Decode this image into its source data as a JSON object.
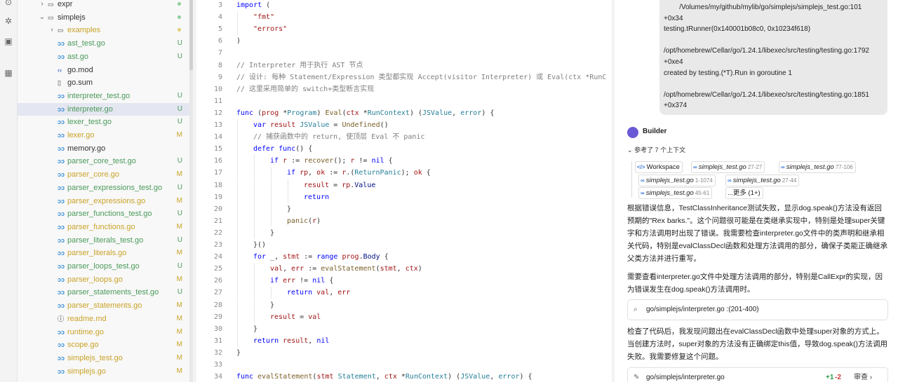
{
  "activity_bar": {
    "icons": [
      "explorer-icon",
      "debug-icon",
      "monitor-icon",
      "extensions-icon"
    ]
  },
  "explorer": {
    "colors": {
      "untracked": "#4a9a5a",
      "modified": "#c9a227",
      "normal": "#333333"
    },
    "rows": [
      {
        "name": "expr",
        "type": "folder",
        "depth": 1,
        "expanded": false,
        "badge": "",
        "status": "normal"
      },
      {
        "name": "simplejs",
        "type": "folder",
        "depth": 1,
        "expanded": true,
        "badge": "",
        "status": "normal"
      },
      {
        "name": "examples",
        "type": "folder",
        "depth": 2,
        "expanded": false,
        "badge": "",
        "status": "modified"
      },
      {
        "name": "ast_test.go",
        "type": "go",
        "depth": 2,
        "badge": "U",
        "status": "untracked"
      },
      {
        "name": "ast.go",
        "type": "go",
        "depth": 2,
        "badge": "U",
        "status": "untracked"
      },
      {
        "name": "go.mod",
        "type": "mod",
        "depth": 2,
        "badge": "",
        "status": "normal"
      },
      {
        "name": "go.sum",
        "type": "sum",
        "depth": 2,
        "badge": "",
        "status": "normal"
      },
      {
        "name": "interpreter_test.go",
        "type": "go",
        "depth": 2,
        "badge": "U",
        "status": "untracked"
      },
      {
        "name": "interpreter.go",
        "type": "go",
        "depth": 2,
        "badge": "U",
        "status": "untracked",
        "selected": true
      },
      {
        "name": "lexer_test.go",
        "type": "go",
        "depth": 2,
        "badge": "U",
        "status": "untracked"
      },
      {
        "name": "lexer.go",
        "type": "go",
        "depth": 2,
        "badge": "M",
        "status": "modified"
      },
      {
        "name": "memory.go",
        "type": "go",
        "depth": 2,
        "badge": "",
        "status": "normal"
      },
      {
        "name": "parser_core_test.go",
        "type": "go",
        "depth": 2,
        "badge": "U",
        "status": "untracked"
      },
      {
        "name": "parser_core.go",
        "type": "go",
        "depth": 2,
        "badge": "M",
        "status": "modified"
      },
      {
        "name": "parser_expressions_test.go",
        "type": "go",
        "depth": 2,
        "badge": "U",
        "status": "untracked"
      },
      {
        "name": "parser_expressions.go",
        "type": "go",
        "depth": 2,
        "badge": "M",
        "status": "modified"
      },
      {
        "name": "parser_functions_test.go",
        "type": "go",
        "depth": 2,
        "badge": "U",
        "status": "untracked"
      },
      {
        "name": "parser_functions.go",
        "type": "go",
        "depth": 2,
        "badge": "M",
        "status": "modified"
      },
      {
        "name": "parser_literals_test.go",
        "type": "go",
        "depth": 2,
        "badge": "U",
        "status": "untracked"
      },
      {
        "name": "parser_literals.go",
        "type": "go",
        "depth": 2,
        "badge": "M",
        "status": "modified"
      },
      {
        "name": "parser_loops_test.go",
        "type": "go",
        "depth": 2,
        "badge": "U",
        "status": "untracked"
      },
      {
        "name": "parser_loops.go",
        "type": "go",
        "depth": 2,
        "badge": "M",
        "status": "modified"
      },
      {
        "name": "parser_statements_test.go",
        "type": "go",
        "depth": 2,
        "badge": "U",
        "status": "untracked"
      },
      {
        "name": "parser_statements.go",
        "type": "go",
        "depth": 2,
        "badge": "M",
        "status": "modified"
      },
      {
        "name": "readme.md",
        "type": "md",
        "depth": 2,
        "badge": "M",
        "status": "modified"
      },
      {
        "name": "runtime.go",
        "type": "go",
        "depth": 2,
        "badge": "M",
        "status": "modified"
      },
      {
        "name": "scope.go",
        "type": "go",
        "depth": 2,
        "badge": "M",
        "status": "modified"
      },
      {
        "name": "simplejs_test.go",
        "type": "go",
        "depth": 2,
        "badge": "M",
        "status": "modified"
      },
      {
        "name": "simplejs.go",
        "type": "go",
        "depth": 2,
        "badge": "M",
        "status": "modified"
      }
    ]
  },
  "editor": {
    "lines": [
      {
        "n": 3,
        "indent": 0,
        "t": [
          [
            "kw",
            "import"
          ],
          [
            "p",
            " ("
          ]
        ]
      },
      {
        "n": 4,
        "indent": 1,
        "t": [
          [
            "str",
            "\"fmt\""
          ]
        ]
      },
      {
        "n": 5,
        "indent": 1,
        "t": [
          [
            "str",
            "\"errors\""
          ]
        ]
      },
      {
        "n": 6,
        "indent": 0,
        "t": [
          [
            "p",
            ")"
          ]
        ]
      },
      {
        "n": 7,
        "indent": 0,
        "t": []
      },
      {
        "n": 8,
        "indent": 0,
        "t": [
          [
            "cm",
            "// Interpreter 用于执行 AST 节点"
          ]
        ]
      },
      {
        "n": 9,
        "indent": 0,
        "t": [
          [
            "cm",
            "// 设计: 每种 Statement/Expression 类型都实现 Accept(visitor Interpreter) 或 Eval(ctx *RunC"
          ]
        ]
      },
      {
        "n": 10,
        "indent": 0,
        "t": [
          [
            "cm",
            "// 这里采用简单的 switch+类型断言实现"
          ]
        ]
      },
      {
        "n": 11,
        "indent": 0,
        "t": []
      },
      {
        "n": 12,
        "indent": 0,
        "t": [
          [
            "kw",
            "func"
          ],
          [
            "p",
            " ("
          ],
          [
            "pm",
            "prog"
          ],
          [
            "p",
            " *"
          ],
          [
            "ty",
            "Program"
          ],
          [
            "p",
            ") "
          ],
          [
            "fn",
            "Eval"
          ],
          [
            "p",
            "("
          ],
          [
            "pm",
            "ctx"
          ],
          [
            "p",
            " *"
          ],
          [
            "ty",
            "RunContext"
          ],
          [
            "p",
            ") ("
          ],
          [
            "ty",
            "JSValue"
          ],
          [
            "p",
            ", "
          ],
          [
            "ty",
            "error"
          ],
          [
            "p",
            ") {"
          ]
        ]
      },
      {
        "n": 13,
        "indent": 1,
        "t": [
          [
            "kw",
            "var"
          ],
          [
            "p",
            " "
          ],
          [
            "pm",
            "result"
          ],
          [
            "p",
            " "
          ],
          [
            "ty",
            "JSValue"
          ],
          [
            "p",
            " = "
          ],
          [
            "fn",
            "Undefined"
          ],
          [
            "p",
            "()"
          ]
        ]
      },
      {
        "n": 14,
        "indent": 1,
        "t": [
          [
            "cm",
            "// 捕获函数中的 return, 使顶层 Eval 不 panic"
          ]
        ]
      },
      {
        "n": 15,
        "indent": 1,
        "t": [
          [
            "kw",
            "defer"
          ],
          [
            "p",
            " "
          ],
          [
            "kw",
            "func"
          ],
          [
            "p",
            "() {"
          ]
        ]
      },
      {
        "n": 16,
        "indent": 2,
        "t": [
          [
            "kw",
            "if"
          ],
          [
            "p",
            " "
          ],
          [
            "pm",
            "r"
          ],
          [
            "p",
            " := "
          ],
          [
            "fn",
            "recover"
          ],
          [
            "p",
            "(); "
          ],
          [
            "pm",
            "r"
          ],
          [
            "p",
            " != "
          ],
          [
            "kw",
            "nil"
          ],
          [
            "p",
            " {"
          ]
        ]
      },
      {
        "n": 17,
        "indent": 3,
        "t": [
          [
            "kw",
            "if"
          ],
          [
            "p",
            " "
          ],
          [
            "pm",
            "rp"
          ],
          [
            "p",
            ", "
          ],
          [
            "pm",
            "ok"
          ],
          [
            "p",
            " := "
          ],
          [
            "pm",
            "r"
          ],
          [
            "p",
            ".("
          ],
          [
            "ty",
            "ReturnPanic"
          ],
          [
            "p",
            "); "
          ],
          [
            "pm",
            "ok"
          ],
          [
            "p",
            " {"
          ]
        ]
      },
      {
        "n": 18,
        "indent": 4,
        "t": [
          [
            "pm",
            "result"
          ],
          [
            "p",
            " = "
          ],
          [
            "pm",
            "rp"
          ],
          [
            "p",
            "."
          ],
          [
            "vr",
            "Value"
          ]
        ]
      },
      {
        "n": 19,
        "indent": 4,
        "t": [
          [
            "kw",
            "return"
          ]
        ]
      },
      {
        "n": 20,
        "indent": 3,
        "t": [
          [
            "p",
            "}"
          ]
        ]
      },
      {
        "n": 21,
        "indent": 3,
        "t": [
          [
            "fn",
            "panic"
          ],
          [
            "p",
            "("
          ],
          [
            "pm",
            "r"
          ],
          [
            "p",
            ")"
          ]
        ]
      },
      {
        "n": 22,
        "indent": 2,
        "t": [
          [
            "p",
            "}"
          ]
        ]
      },
      {
        "n": 23,
        "indent": 1,
        "t": [
          [
            "p",
            "}()"
          ]
        ]
      },
      {
        "n": 24,
        "indent": 1,
        "t": [
          [
            "kw",
            "for"
          ],
          [
            "p",
            " _, "
          ],
          [
            "pm",
            "stmt"
          ],
          [
            "p",
            " := "
          ],
          [
            "kw",
            "range"
          ],
          [
            "p",
            " "
          ],
          [
            "pm",
            "prog"
          ],
          [
            "p",
            "."
          ],
          [
            "vr",
            "Body"
          ],
          [
            "p",
            " {"
          ]
        ]
      },
      {
        "n": 25,
        "indent": 2,
        "t": [
          [
            "pm",
            "val"
          ],
          [
            "p",
            ", "
          ],
          [
            "pm",
            "err"
          ],
          [
            "p",
            " := "
          ],
          [
            "fn",
            "evalStatement"
          ],
          [
            "p",
            "("
          ],
          [
            "pm",
            "stmt"
          ],
          [
            "p",
            ", "
          ],
          [
            "pm",
            "ctx"
          ],
          [
            "p",
            ")"
          ]
        ]
      },
      {
        "n": 26,
        "indent": 2,
        "t": [
          [
            "kw",
            "if"
          ],
          [
            "p",
            " "
          ],
          [
            "pm",
            "err"
          ],
          [
            "p",
            " != "
          ],
          [
            "kw",
            "nil"
          ],
          [
            "p",
            " {"
          ]
        ]
      },
      {
        "n": 27,
        "indent": 3,
        "t": [
          [
            "kw",
            "return"
          ],
          [
            "p",
            " "
          ],
          [
            "pm",
            "val"
          ],
          [
            "p",
            ", "
          ],
          [
            "pm",
            "err"
          ]
        ]
      },
      {
        "n": 28,
        "indent": 2,
        "t": [
          [
            "p",
            "}"
          ]
        ]
      },
      {
        "n": 29,
        "indent": 2,
        "t": [
          [
            "pm",
            "result"
          ],
          [
            "p",
            " = "
          ],
          [
            "pm",
            "val"
          ]
        ]
      },
      {
        "n": 30,
        "indent": 1,
        "t": [
          [
            "p",
            "}"
          ]
        ]
      },
      {
        "n": 31,
        "indent": 1,
        "t": [
          [
            "kw",
            "return"
          ],
          [
            "p",
            " "
          ],
          [
            "pm",
            "result"
          ],
          [
            "p",
            ", "
          ],
          [
            "kw",
            "nil"
          ]
        ]
      },
      {
        "n": 32,
        "indent": 0,
        "t": [
          [
            "p",
            "}"
          ]
        ]
      },
      {
        "n": 33,
        "indent": 0,
        "t": []
      },
      {
        "n": 34,
        "indent": 0,
        "t": [
          [
            "kw",
            "func"
          ],
          [
            "p",
            " "
          ],
          [
            "fn",
            "evalStatement"
          ],
          [
            "p",
            "("
          ],
          [
            "pm",
            "stmt"
          ],
          [
            "p",
            " "
          ],
          [
            "ty",
            "Statement"
          ],
          [
            "p",
            ", "
          ],
          [
            "pm",
            "ctx"
          ],
          [
            "p",
            " *"
          ],
          [
            "ty",
            "RunContext"
          ],
          [
            "p",
            ") ("
          ],
          [
            "ty",
            "JSValue"
          ],
          [
            "p",
            ", "
          ],
          [
            "ty",
            "error"
          ],
          [
            "p",
            ") {"
          ]
        ]
      }
    ]
  },
  "chat": {
    "trace_lines": [
      "        /Volumes/my/github/mylib/go/simplejs/simplejs_test.go:101",
      "+0x34",
      "testing.tRunner(0x140001b08c0, 0x10234f618)",
      "",
      "/opt/homebrew/Cellar/go/1.24.1/libexec/src/testing/testing.go:1792",
      "+0xe4",
      "created by testing.(*T).Run in goroutine 1",
      "",
      "/opt/homebrew/Cellar/go/1.24.1/libexec/src/testing/testing.go:1851",
      "+0x374"
    ],
    "builder_name": "Builder",
    "ref_toggle": "参考了 7 个上下文",
    "chips": [
      {
        "icon": "</>",
        "name": "Workspace",
        "range": ""
      },
      {
        "icon": "∞",
        "name": "simplejs_test.go",
        "range": "27-27"
      },
      {
        "icon": "∞",
        "name": "simplejs_test.go",
        "range": "77-106"
      },
      {
        "icon": "∞",
        "name": "simplejs_test.go",
        "range": "1-1074"
      },
      {
        "icon": "∞",
        "name": "simplejs_test.go",
        "range": "27-44"
      },
      {
        "icon": "∞",
        "name": "simplejs_test.go",
        "range": "45-61"
      },
      {
        "icon": "",
        "name": "...更多 (1+)",
        "range": ""
      }
    ],
    "para1": "根据错误信息，TestClassInheritance测试失败，显示dog.speak()方法没有返回预期的\"Rex barks.\"。这个问题很可能是在类继承实现中，特别是处理super关键字和方法调用时出现了错误。我需要检查interpreter.go文件中的类声明和继承相关代码，特别是evalClassDecl函数和处理方法调用的部分，确保子类能正确继承父类方法并进行重写。",
    "para2": "需要查看interpreter.go文件中处理方法调用的部分，特别是CallExpr的实现，因为错误发生在dog.speak()方法调用时。",
    "tool1": "go/simplejs/interpreter.go :(201-400)",
    "para3": "检查了代码后，我发现问题出在evalClassDecl函数中处理super对象的方式上。当创建方法时，super对象的方法没有正确绑定this值，导致dog.speak()方法调用失败。我需要修复这个问题。",
    "tool2": "go/simplejs/interpreter.go",
    "diff_add": "+1",
    "diff_del": "-2",
    "review_label": "审查"
  }
}
